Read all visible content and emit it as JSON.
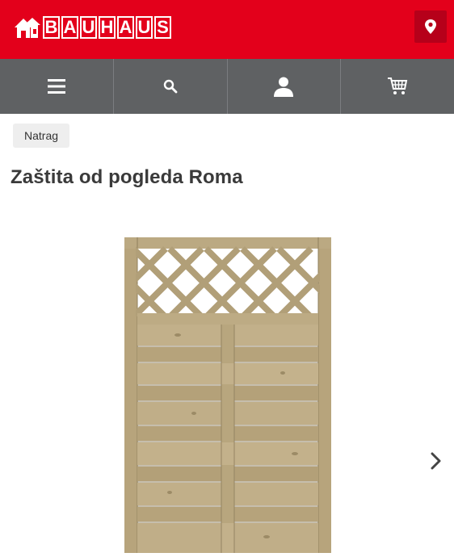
{
  "header": {
    "brand_letters": [
      "B",
      "A",
      "U",
      "H",
      "A",
      "U",
      "S"
    ],
    "brand_color": "#e3001b",
    "location_icon": "map-pin-icon"
  },
  "nav": {
    "items": [
      {
        "icon": "menu-icon"
      },
      {
        "icon": "search-icon"
      },
      {
        "icon": "user-icon"
      },
      {
        "icon": "cart-icon"
      }
    ],
    "background": "#5f6163"
  },
  "page": {
    "back_label": "Natrag",
    "product_title": "Zaštita od pogleda Roma",
    "next_icon": "chevron-right-icon"
  }
}
